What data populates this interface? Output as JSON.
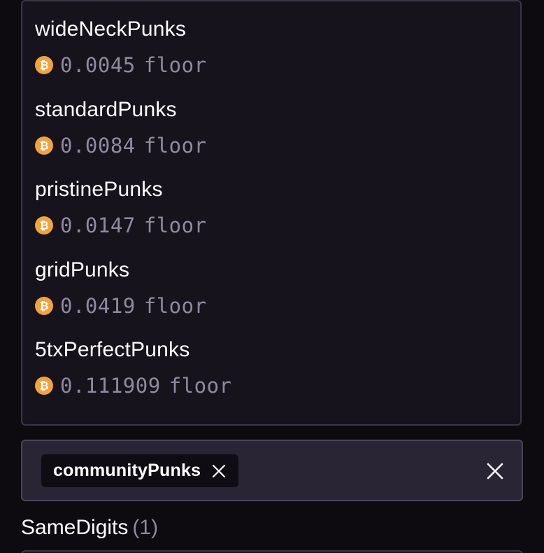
{
  "traits": {
    "items": [
      {
        "name": "wideNeckPunks",
        "price": "0.0045",
        "suffix": "floor"
      },
      {
        "name": "standardPunks",
        "price": "0.0084",
        "suffix": "floor"
      },
      {
        "name": "pristinePunks",
        "price": "0.0147",
        "suffix": "floor"
      },
      {
        "name": "gridPunks",
        "price": "0.0419",
        "suffix": "floor"
      },
      {
        "name": "5txPerfectPunks",
        "price": "0.111909",
        "suffix": "floor"
      }
    ],
    "currency_icon": "bitcoin-icon"
  },
  "filter": {
    "chip_label": "communityPunks",
    "chip_remove_icon": "close-icon",
    "clear_icon": "close-icon"
  },
  "section": {
    "title": "SameDigits",
    "count": "(1)"
  },
  "colors": {
    "background": "#0d0b10",
    "panel": "#16131d",
    "filter_bg": "#2a2535",
    "chip_bg": "#0f0d13",
    "muted_text": "#8f8a9e",
    "bitcoin_orange": "#f2a33a"
  }
}
